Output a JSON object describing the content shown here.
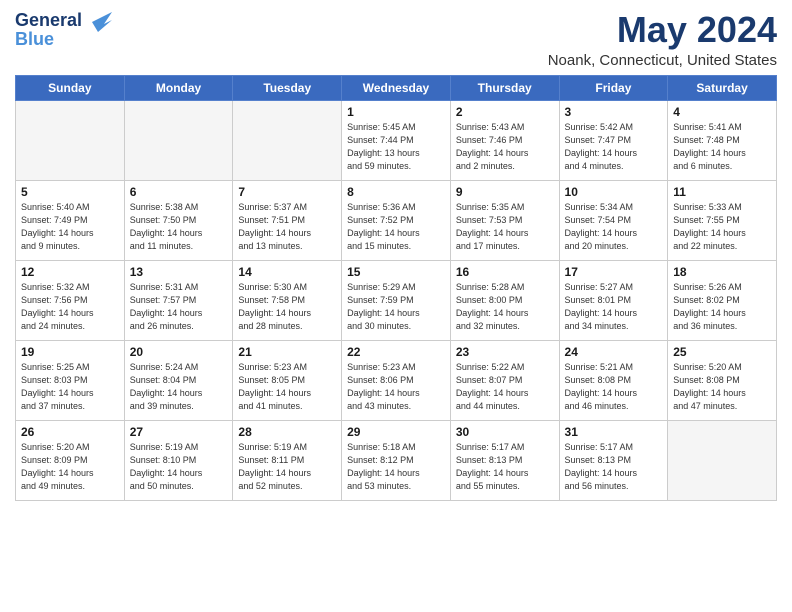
{
  "logo": {
    "line1": "General",
    "line2": "Blue"
  },
  "title": "May 2024",
  "location": "Noank, Connecticut, United States",
  "days_header": [
    "Sunday",
    "Monday",
    "Tuesday",
    "Wednesday",
    "Thursday",
    "Friday",
    "Saturday"
  ],
  "weeks": [
    [
      {
        "day": "",
        "info": ""
      },
      {
        "day": "",
        "info": ""
      },
      {
        "day": "",
        "info": ""
      },
      {
        "day": "1",
        "info": "Sunrise: 5:45 AM\nSunset: 7:44 PM\nDaylight: 13 hours\nand 59 minutes."
      },
      {
        "day": "2",
        "info": "Sunrise: 5:43 AM\nSunset: 7:46 PM\nDaylight: 14 hours\nand 2 minutes."
      },
      {
        "day": "3",
        "info": "Sunrise: 5:42 AM\nSunset: 7:47 PM\nDaylight: 14 hours\nand 4 minutes."
      },
      {
        "day": "4",
        "info": "Sunrise: 5:41 AM\nSunset: 7:48 PM\nDaylight: 14 hours\nand 6 minutes."
      }
    ],
    [
      {
        "day": "5",
        "info": "Sunrise: 5:40 AM\nSunset: 7:49 PM\nDaylight: 14 hours\nand 9 minutes."
      },
      {
        "day": "6",
        "info": "Sunrise: 5:38 AM\nSunset: 7:50 PM\nDaylight: 14 hours\nand 11 minutes."
      },
      {
        "day": "7",
        "info": "Sunrise: 5:37 AM\nSunset: 7:51 PM\nDaylight: 14 hours\nand 13 minutes."
      },
      {
        "day": "8",
        "info": "Sunrise: 5:36 AM\nSunset: 7:52 PM\nDaylight: 14 hours\nand 15 minutes."
      },
      {
        "day": "9",
        "info": "Sunrise: 5:35 AM\nSunset: 7:53 PM\nDaylight: 14 hours\nand 17 minutes."
      },
      {
        "day": "10",
        "info": "Sunrise: 5:34 AM\nSunset: 7:54 PM\nDaylight: 14 hours\nand 20 minutes."
      },
      {
        "day": "11",
        "info": "Sunrise: 5:33 AM\nSunset: 7:55 PM\nDaylight: 14 hours\nand 22 minutes."
      }
    ],
    [
      {
        "day": "12",
        "info": "Sunrise: 5:32 AM\nSunset: 7:56 PM\nDaylight: 14 hours\nand 24 minutes."
      },
      {
        "day": "13",
        "info": "Sunrise: 5:31 AM\nSunset: 7:57 PM\nDaylight: 14 hours\nand 26 minutes."
      },
      {
        "day": "14",
        "info": "Sunrise: 5:30 AM\nSunset: 7:58 PM\nDaylight: 14 hours\nand 28 minutes."
      },
      {
        "day": "15",
        "info": "Sunrise: 5:29 AM\nSunset: 7:59 PM\nDaylight: 14 hours\nand 30 minutes."
      },
      {
        "day": "16",
        "info": "Sunrise: 5:28 AM\nSunset: 8:00 PM\nDaylight: 14 hours\nand 32 minutes."
      },
      {
        "day": "17",
        "info": "Sunrise: 5:27 AM\nSunset: 8:01 PM\nDaylight: 14 hours\nand 34 minutes."
      },
      {
        "day": "18",
        "info": "Sunrise: 5:26 AM\nSunset: 8:02 PM\nDaylight: 14 hours\nand 36 minutes."
      }
    ],
    [
      {
        "day": "19",
        "info": "Sunrise: 5:25 AM\nSunset: 8:03 PM\nDaylight: 14 hours\nand 37 minutes."
      },
      {
        "day": "20",
        "info": "Sunrise: 5:24 AM\nSunset: 8:04 PM\nDaylight: 14 hours\nand 39 minutes."
      },
      {
        "day": "21",
        "info": "Sunrise: 5:23 AM\nSunset: 8:05 PM\nDaylight: 14 hours\nand 41 minutes."
      },
      {
        "day": "22",
        "info": "Sunrise: 5:23 AM\nSunset: 8:06 PM\nDaylight: 14 hours\nand 43 minutes."
      },
      {
        "day": "23",
        "info": "Sunrise: 5:22 AM\nSunset: 8:07 PM\nDaylight: 14 hours\nand 44 minutes."
      },
      {
        "day": "24",
        "info": "Sunrise: 5:21 AM\nSunset: 8:08 PM\nDaylight: 14 hours\nand 46 minutes."
      },
      {
        "day": "25",
        "info": "Sunrise: 5:20 AM\nSunset: 8:08 PM\nDaylight: 14 hours\nand 47 minutes."
      }
    ],
    [
      {
        "day": "26",
        "info": "Sunrise: 5:20 AM\nSunset: 8:09 PM\nDaylight: 14 hours\nand 49 minutes."
      },
      {
        "day": "27",
        "info": "Sunrise: 5:19 AM\nSunset: 8:10 PM\nDaylight: 14 hours\nand 50 minutes."
      },
      {
        "day": "28",
        "info": "Sunrise: 5:19 AM\nSunset: 8:11 PM\nDaylight: 14 hours\nand 52 minutes."
      },
      {
        "day": "29",
        "info": "Sunrise: 5:18 AM\nSunset: 8:12 PM\nDaylight: 14 hours\nand 53 minutes."
      },
      {
        "day": "30",
        "info": "Sunrise: 5:17 AM\nSunset: 8:13 PM\nDaylight: 14 hours\nand 55 minutes."
      },
      {
        "day": "31",
        "info": "Sunrise: 5:17 AM\nSunset: 8:13 PM\nDaylight: 14 hours\nand 56 minutes."
      },
      {
        "day": "",
        "info": ""
      }
    ]
  ]
}
